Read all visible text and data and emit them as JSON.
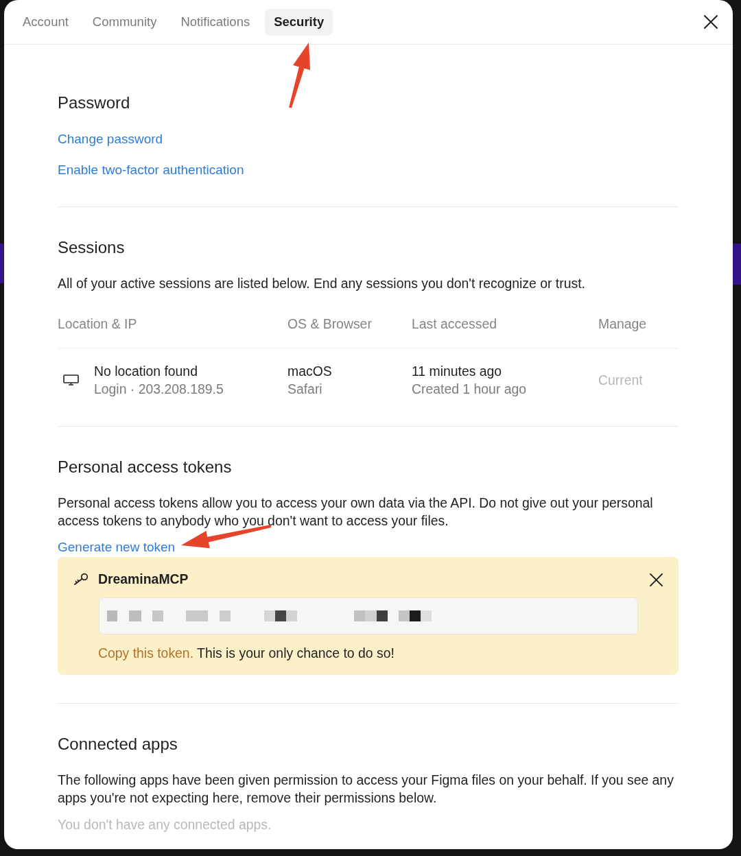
{
  "dialog": {
    "tabs": [
      {
        "label": "Account",
        "selected": false
      },
      {
        "label": "Community",
        "selected": false
      },
      {
        "label": "Notifications",
        "selected": false
      },
      {
        "label": "Security",
        "selected": true
      }
    ]
  },
  "password": {
    "heading": "Password",
    "links": [
      "Change password",
      "Enable two-factor authentication"
    ]
  },
  "sessions": {
    "heading": "Sessions",
    "description": "All of your active sessions are listed below. End any sessions you don't recognize or trust.",
    "columns": [
      "Location & IP",
      "OS & Browser",
      "Last accessed",
      "Manage"
    ],
    "rows": [
      {
        "location": "No location found",
        "login": "Login · 203.208.189.5",
        "os": "macOS",
        "browser": "Safari",
        "last_accessed": "11 minutes ago",
        "created": "Created 1 hour ago",
        "manage": "Current"
      }
    ]
  },
  "personal_access_tokens": {
    "heading": "Personal access tokens",
    "description": "Personal access tokens allow you to access your own data via the API. Do not give out your personal access tokens to anybody who you don't want to access your files.",
    "action": "Generate new token",
    "new_token": {
      "name": "DreaminaMCP",
      "copy_action": "Copy this token.",
      "notice": "This is your only chance to do so!"
    }
  },
  "connected_apps": {
    "heading": "Connected apps",
    "description": "The following apps have been given permission to access your Figma files on your behalf. If you see any apps you're not expecting here, remove their permissions below.",
    "empty_message": "You don't have any connected apps."
  }
}
